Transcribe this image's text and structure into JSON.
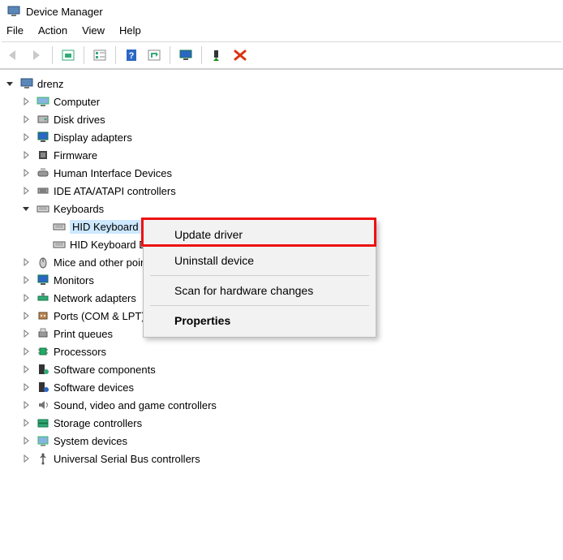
{
  "window": {
    "title": "Device Manager"
  },
  "menu": {
    "items": [
      "File",
      "Action",
      "View",
      "Help"
    ]
  },
  "toolbar": {
    "buttons": [
      {
        "name": "back-icon"
      },
      {
        "name": "forward-icon"
      },
      {
        "name": "show-hidden-icon"
      },
      {
        "name": "properties-tb-icon"
      },
      {
        "name": "help-tb-icon"
      },
      {
        "name": "scan-tb-icon"
      },
      {
        "name": "monitor-tb-icon"
      },
      {
        "name": "install-tb-icon"
      },
      {
        "name": "remove-tb-icon"
      }
    ]
  },
  "tree": {
    "root": {
      "label": "drenz",
      "expanded": true
    },
    "items": [
      {
        "label": "Computer",
        "icon": "computer-icon",
        "chevron": "right"
      },
      {
        "label": "Disk drives",
        "icon": "disk-icon",
        "chevron": "right"
      },
      {
        "label": "Display adapters",
        "icon": "display-icon",
        "chevron": "right"
      },
      {
        "label": "Firmware",
        "icon": "firmware-icon",
        "chevron": "right"
      },
      {
        "label": "Human Interface Devices",
        "icon": "hid-icon",
        "chevron": "right"
      },
      {
        "label": "IDE ATA/ATAPI controllers",
        "icon": "ide-icon",
        "chevron": "right"
      },
      {
        "label": "Keyboards",
        "icon": "keyboard-icon",
        "chevron": "down",
        "children": [
          {
            "label": "HID Keyboard Device",
            "icon": "keyboard-icon",
            "selected": true
          },
          {
            "label": "HID Keyboard Device",
            "icon": "keyboard-icon"
          }
        ]
      },
      {
        "label": "Mice and other pointing devices",
        "icon": "mouse-icon",
        "chevron": "right"
      },
      {
        "label": "Monitors",
        "icon": "monitor-cat-icon",
        "chevron": "right"
      },
      {
        "label": "Network adapters",
        "icon": "network-icon",
        "chevron": "right"
      },
      {
        "label": "Ports (COM & LPT)",
        "icon": "port-icon",
        "chevron": "right"
      },
      {
        "label": "Print queues",
        "icon": "printer-icon",
        "chevron": "right"
      },
      {
        "label": "Processors",
        "icon": "cpu-icon",
        "chevron": "right"
      },
      {
        "label": "Software components",
        "icon": "swcomp-icon",
        "chevron": "right"
      },
      {
        "label": "Software devices",
        "icon": "swdev-icon",
        "chevron": "right"
      },
      {
        "label": "Sound, video and game controllers",
        "icon": "sound-icon",
        "chevron": "right"
      },
      {
        "label": "Storage controllers",
        "icon": "storage-icon",
        "chevron": "right"
      },
      {
        "label": "System devices",
        "icon": "system-icon",
        "chevron": "right"
      },
      {
        "label": "Universal Serial Bus controllers",
        "icon": "usb-icon",
        "chevron": "right"
      }
    ]
  },
  "context_menu": {
    "items": [
      {
        "label": "Update driver",
        "highlight": true
      },
      {
        "label": "Uninstall device"
      },
      {
        "sep": true
      },
      {
        "label": "Scan for hardware changes"
      },
      {
        "sep": true
      },
      {
        "label": "Properties",
        "bold": true
      }
    ]
  }
}
